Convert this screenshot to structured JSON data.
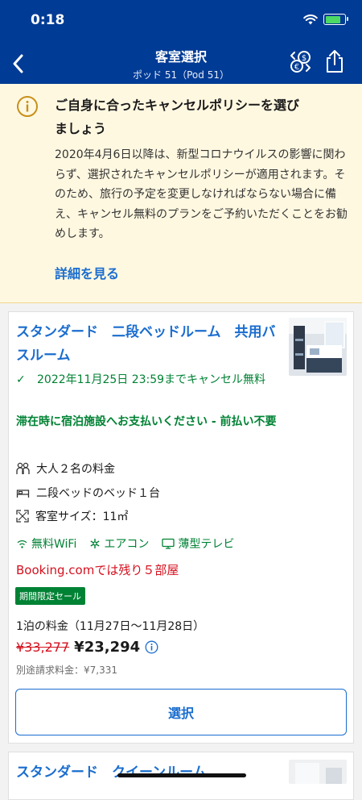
{
  "status_bar": {
    "time": "0:18"
  },
  "header": {
    "title": "客室選択",
    "subtitle": "ポッド 51（Pod 51）"
  },
  "notice": {
    "title": "ご自身に合ったキャンセルポリシーを選びましょう",
    "body": "2020年4月6日以降は、新型コロナウイルスの影響に関わらず、選択されたキャンセルポリシーが適用されます。そのため、旅行の予定を変更しなければならない場合に備え、キャンセル無料のプランをご予約いただくことをお勧めします。",
    "link": "詳細を見る"
  },
  "room": {
    "title": "スタンダード　二段ベッドルーム　共用バスルーム",
    "cancellation": "2022年11月25日 23:59までキャンセル無料",
    "payment": "滞在時に宿泊施設へお支払いください - 前払い不要",
    "guests": "大人２名の料金",
    "bed": "二段ベッドのベッド１台",
    "size": "客室サイズ：11㎡",
    "amenities": [
      "無料WiFi",
      "エアコン",
      "薄型テレビ"
    ],
    "availability": "Booking.comでは残り５部屋",
    "badge": "期間限定セール",
    "nights": "1泊の料金（11月27日〜11月28日）",
    "old_price": "¥33,277",
    "new_price": "¥23,294",
    "extra_charge": "別途請求料金：¥7,331",
    "select_label": "選択"
  },
  "room2": {
    "title": "スタンダード　クイーンルーム"
  },
  "colors": {
    "header_bg": "#003b95",
    "link_blue": "#1a6dcf",
    "green": "#008234",
    "red": "#d4111e",
    "notice_bg": "#fff8e1"
  }
}
